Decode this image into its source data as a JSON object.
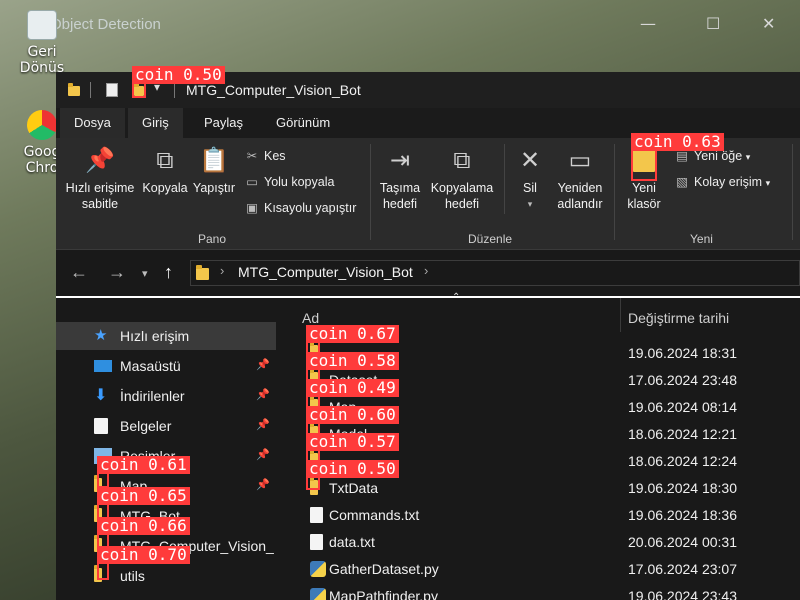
{
  "desktop": {
    "icons": [
      {
        "label_line1": "Geri",
        "label_line2": "Dönüş",
        "icon": "recycle-bin-icon"
      },
      {
        "label_line1": "Goog",
        "label_line2": "Chro",
        "icon": "chrome-icon"
      }
    ],
    "background_window_title": "Object Detection",
    "controls": {
      "minimize": "—",
      "maximize": "☐",
      "close": "✕"
    }
  },
  "explorer": {
    "title": "MTG_Computer_Vision_Bot",
    "tabs": [
      "Dosya",
      "Giriş",
      "Paylaş",
      "Görünüm"
    ],
    "ribbon": {
      "pano": {
        "pin": "Hızlı erişime sabitle",
        "copy": "Kopyala",
        "paste": "Yapıştır",
        "cut": "Kes",
        "copy_path": "Yolu kopyala",
        "paste_shortcut": "Kısayolu yapıştır",
        "group": "Pano"
      },
      "duzenle": {
        "move": "Taşıma hedefi",
        "copy_to": "Kopyalama hedefi",
        "delete": "Sil",
        "rename": "Yeniden adlandır",
        "group": "Düzenle"
      },
      "yeni": {
        "new_folder": "Yeni klasör",
        "new_item": "Yeni öğe",
        "easy_access": "Kolay erişim",
        "group": "Yeni"
      }
    },
    "address": {
      "back": "←",
      "forward": "→",
      "up": "↑",
      "path": "MTG_Computer_Vision_Bot"
    },
    "nav": [
      {
        "label": "Hızlı erişim",
        "pinned": false
      },
      {
        "label": "Masaüstü",
        "pinned": true
      },
      {
        "label": "İndirilenler",
        "pinned": true
      },
      {
        "label": "Belgeler",
        "pinned": true
      },
      {
        "label": "Resimler",
        "pinned": true
      },
      {
        "label": "Map",
        "pinned": true
      },
      {
        "label": "MTG_Bot",
        "pinned": false
      },
      {
        "label": "MTG_Computer_Vision_",
        "pinned": false
      },
      {
        "label": "utils",
        "pinned": false
      }
    ],
    "columns": {
      "name": "Ad",
      "modified": "Değiştirme tarihi"
    },
    "files": [
      {
        "name": "",
        "date": "19.06.2024 18:31",
        "type": "folder"
      },
      {
        "name": "Dataset",
        "date": "17.06.2024 23:48",
        "type": "folder"
      },
      {
        "name": "Map",
        "date": "19.06.2024 08:14",
        "type": "folder"
      },
      {
        "name": "Model",
        "date": "18.06.2024 12:21",
        "type": "folder"
      },
      {
        "name": "",
        "date": "18.06.2024 12:24",
        "type": "folder"
      },
      {
        "name": "TxtData",
        "date": "19.06.2024 18:30",
        "type": "folder"
      },
      {
        "name": "Commands.txt",
        "date": "19.06.2024 18:36",
        "type": "text"
      },
      {
        "name": "data.txt",
        "date": "20.06.2024 00:31",
        "type": "text"
      },
      {
        "name": "GatherDataset.py",
        "date": "17.06.2024 23:07",
        "type": "python"
      },
      {
        "name": "MapPathfinder.py",
        "date": "19.06.2024 23:43",
        "type": "python"
      }
    ]
  },
  "detections": [
    {
      "label": "coin 0.50"
    },
    {
      "label": "coin 0.63"
    },
    {
      "label": "coin 0.67"
    },
    {
      "label": "coin 0.58"
    },
    {
      "label": "coin 0.49"
    },
    {
      "label": "coin 0.60"
    },
    {
      "label": "coin 0.57"
    },
    {
      "label": "coin 0.50"
    },
    {
      "label": "coin 0.61"
    },
    {
      "label": "coin 0.65"
    },
    {
      "label": "coin 0.66"
    },
    {
      "label": "coin 0.70"
    }
  ],
  "colors": {
    "detection": "#ff3b3b",
    "folder": "#f3c64b",
    "window_bg": "#191919"
  }
}
